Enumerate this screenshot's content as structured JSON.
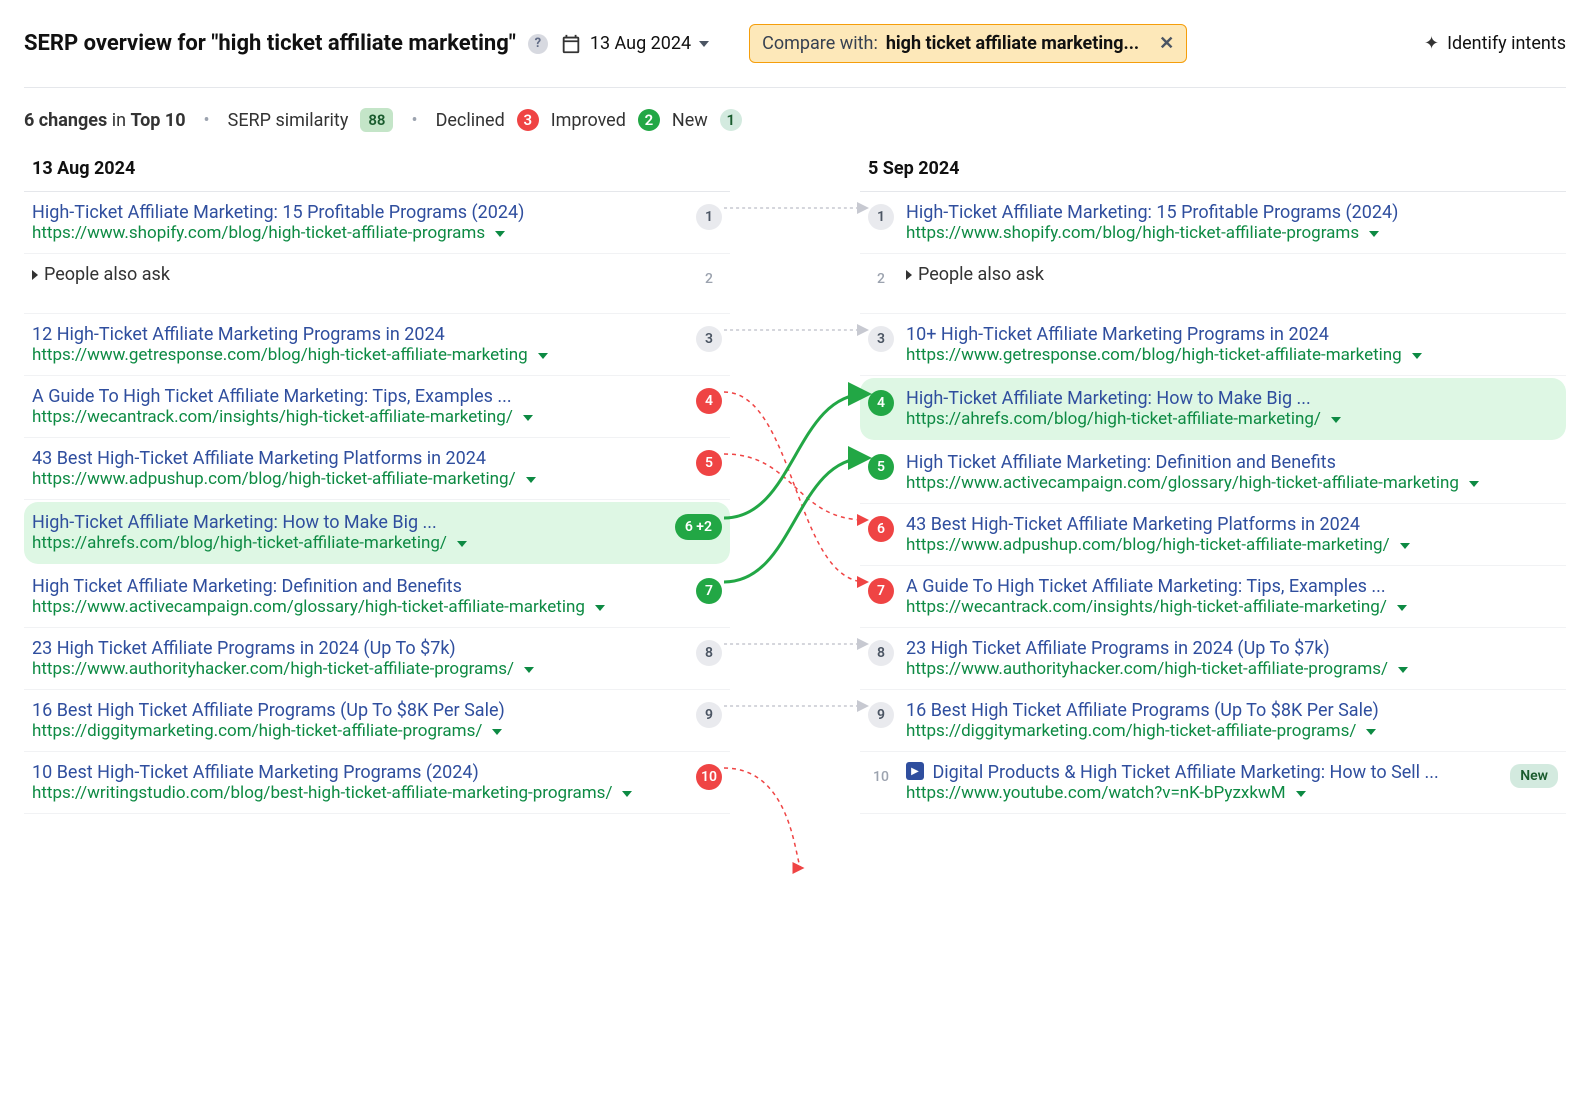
{
  "header": {
    "title_prefix": "SERP overview for ",
    "title_query": "\"high ticket affiliate marketing\"",
    "date": "13 Aug 2024",
    "compare_label": "Compare with: ",
    "compare_value": "high ticket affiliate marketing...",
    "identify_intents": "Identify intents"
  },
  "stats": {
    "changes_count": "6 changes",
    "changes_in": " in ",
    "changes_scope": "Top 10",
    "similarity_label": "SERP similarity",
    "similarity_value": "88",
    "declined_label": "Declined",
    "declined_count": "3",
    "improved_label": "Improved",
    "improved_count": "2",
    "new_label": "New",
    "new_count": "1"
  },
  "col": {
    "left_date": "13 Aug 2024",
    "right_date": "5 Sep 2024"
  },
  "left": [
    {
      "idx": "l1",
      "rank": "1",
      "rank_style": "gray",
      "title": "High-Ticket Affiliate Marketing: 15 Profitable Programs (2024)",
      "url": "https://www.shopify.com/blog/high-ticket-affiliate-programs"
    },
    {
      "idx": "l2",
      "rank": "2",
      "rank_style": "text",
      "feature": "People also ask"
    },
    {
      "idx": "l3",
      "rank": "3",
      "rank_style": "gray",
      "title": "12 High-Ticket Affiliate Marketing Programs in 2024",
      "url": "https://www.getresponse.com/blog/high-ticket-affiliate-marketing"
    },
    {
      "idx": "l4",
      "rank": "4",
      "rank_style": "red",
      "title": "A Guide To High Ticket Affiliate Marketing: Tips, Examples ...",
      "url": "https://wecantrack.com/insights/high-ticket-affiliate-marketing/"
    },
    {
      "idx": "l5",
      "rank": "5",
      "rank_style": "red",
      "title": "43 Best High-Ticket Affiliate Marketing Platforms in 2024",
      "url": "https://www.adpushup.com/blog/high-ticket-affiliate-marketing/"
    },
    {
      "idx": "l6",
      "rank": "6",
      "rank_delta": "+2",
      "highlight": true,
      "title": "High-Ticket Affiliate Marketing: How to Make Big ...",
      "url": "https://ahrefs.com/blog/high-ticket-affiliate-marketing/"
    },
    {
      "idx": "l7",
      "rank": "7",
      "rank_style": "green",
      "title": "High Ticket Affiliate Marketing: Definition and Benefits",
      "url": "https://www.activecampaign.com/glossary/high-ticket-affiliate-marketing"
    },
    {
      "idx": "l8",
      "rank": "8",
      "rank_style": "gray",
      "title": "23 High Ticket Affiliate Programs in 2024 (Up To $7k)",
      "url": "https://www.authorityhacker.com/high-ticket-affiliate-programs/"
    },
    {
      "idx": "l9",
      "rank": "9",
      "rank_style": "gray",
      "title": "16 Best High Ticket Affiliate Programs (Up To $8K Per Sale)",
      "url": "https://diggitymarketing.com/high-ticket-affiliate-programs/"
    },
    {
      "idx": "l10",
      "rank": "10",
      "rank_style": "red",
      "title": "10 Best High-Ticket Affiliate Marketing Programs (2024)",
      "url": "https://writingstudio.com/blog/best-high-ticket-affiliate-marketing-programs/"
    }
  ],
  "right": [
    {
      "idx": "r1",
      "rank": "1",
      "rank_style": "gray",
      "title": "High-Ticket Affiliate Marketing: 15 Profitable Programs (2024)",
      "url": "https://www.shopify.com/blog/high-ticket-affiliate-programs"
    },
    {
      "idx": "r2",
      "rank": "2",
      "rank_style": "text",
      "feature": "People also ask"
    },
    {
      "idx": "r3",
      "rank": "3",
      "rank_style": "gray",
      "title": "10+ High-Ticket Affiliate Marketing Programs in 2024",
      "url": "https://www.getresponse.com/blog/high-ticket-affiliate-marketing"
    },
    {
      "idx": "r4",
      "rank": "4",
      "rank_style": "green",
      "highlight": true,
      "title": "High-Ticket Affiliate Marketing: How to Make Big ...",
      "url": "https://ahrefs.com/blog/high-ticket-affiliate-marketing/"
    },
    {
      "idx": "r5",
      "rank": "5",
      "rank_style": "green",
      "title": "High Ticket Affiliate Marketing: Definition and Benefits",
      "url": "https://www.activecampaign.com/glossary/high-ticket-affiliate-marketing"
    },
    {
      "idx": "r6",
      "rank": "6",
      "rank_style": "red",
      "title": "43 Best High-Ticket Affiliate Marketing Platforms in 2024",
      "url": "https://www.adpushup.com/blog/high-ticket-affiliate-marketing/"
    },
    {
      "idx": "r7",
      "rank": "7",
      "rank_style": "red",
      "title": "A Guide To High Ticket Affiliate Marketing: Tips, Examples ...",
      "url": "https://wecantrack.com/insights/high-ticket-affiliate-marketing/"
    },
    {
      "idx": "r8",
      "rank": "8",
      "rank_style": "gray",
      "title": "23 High Ticket Affiliate Programs in 2024 (Up To $7k)",
      "url": "https://www.authorityhacker.com/high-ticket-affiliate-programs/"
    },
    {
      "idx": "r9",
      "rank": "9",
      "rank_style": "gray",
      "title": "16 Best High Ticket Affiliate Programs (Up To $8K Per Sale)",
      "url": "https://diggitymarketing.com/high-ticket-affiliate-programs/"
    },
    {
      "idx": "r10",
      "rank": "10",
      "rank_style": "text",
      "video": true,
      "new_badge": "New",
      "title": "Digital Products & High Ticket Affiliate Marketing: How to Sell ...",
      "url": "https://www.youtube.com/watch?v=nK-bPyzxkwM"
    }
  ],
  "connections": [
    {
      "from": "l1",
      "to": "r1",
      "kind": "same"
    },
    {
      "from": "l3",
      "to": "r3",
      "kind": "same"
    },
    {
      "from": "l4",
      "to": "r7",
      "kind": "down"
    },
    {
      "from": "l5",
      "to": "r6",
      "kind": "down"
    },
    {
      "from": "l6",
      "to": "r4",
      "kind": "up"
    },
    {
      "from": "l7",
      "to": "r5",
      "kind": "up"
    },
    {
      "from": "l8",
      "to": "r8",
      "kind": "same"
    },
    {
      "from": "l9",
      "to": "r9",
      "kind": "same"
    },
    {
      "from": "l10",
      "to": null,
      "kind": "out"
    }
  ]
}
